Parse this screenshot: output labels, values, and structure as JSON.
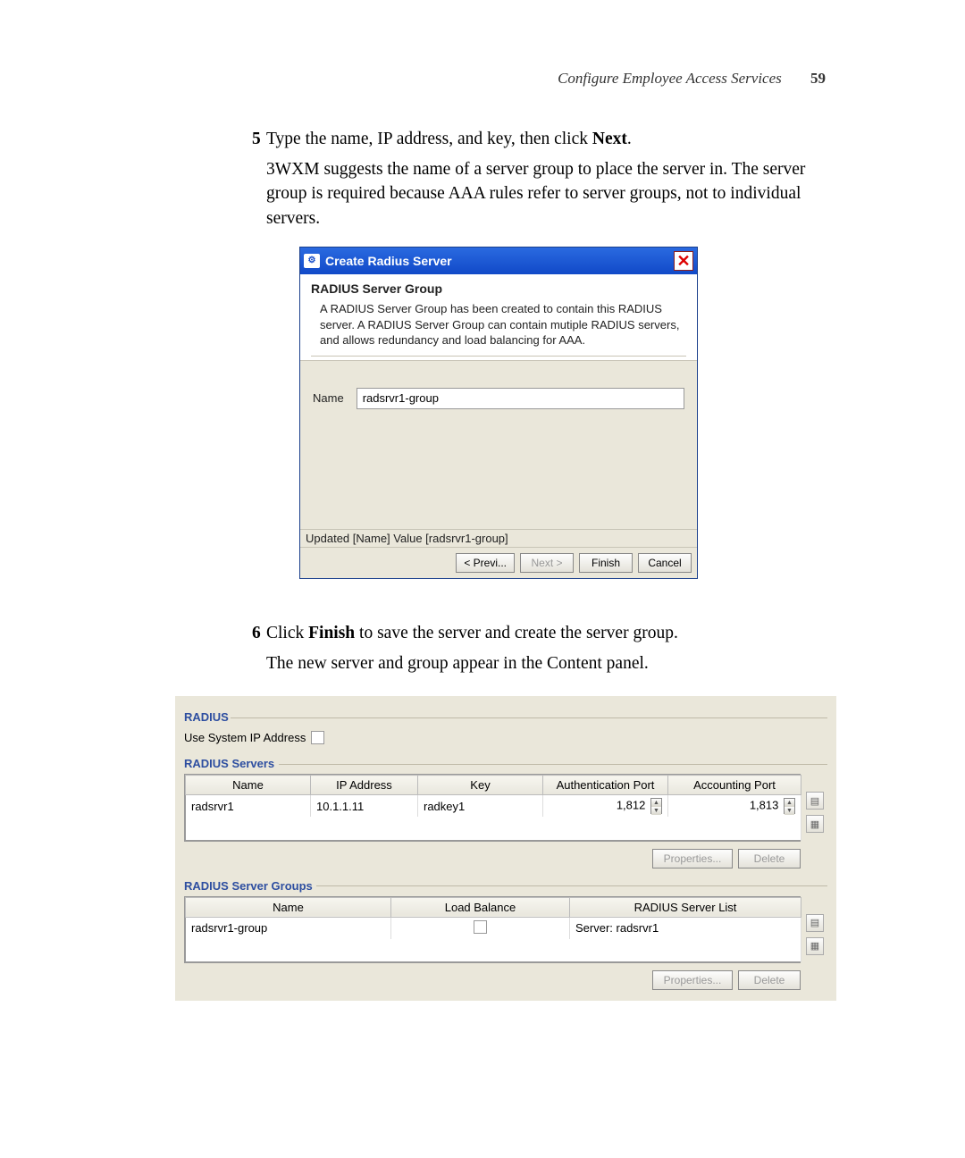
{
  "header": {
    "section_title": "Configure Employee Access Services",
    "page_number": "59"
  },
  "step5": {
    "number": "5",
    "intro_before": "Type the name, IP address, and key, then click ",
    "intro_bold": "Next",
    "intro_after": ".",
    "para": "3WXM suggests the name of a server group to place the server in. The server group is required because AAA rules refer to server groups, not to individual servers."
  },
  "dialog": {
    "title": "Create Radius Server",
    "heading": "RADIUS Server Group",
    "description": "A RADIUS Server Group has been created to contain this RADIUS server. A RADIUS Server Group can contain mutiple RADIUS servers, and allows redundancy and load balancing for AAA.",
    "name_label": "Name",
    "name_value": "radsrvr1-group",
    "status": "Updated [Name] Value [radsrvr1-group]",
    "buttons": {
      "prev": "< Previ...",
      "next": "Next >",
      "finish": "Finish",
      "cancel": "Cancel"
    }
  },
  "step6": {
    "number": "6",
    "intro_before": "Click ",
    "intro_bold": "Finish",
    "intro_after": " to save the server and create the server group.",
    "para": "The new server and group appear in the Content panel."
  },
  "panel": {
    "radius_label": "RADIUS",
    "use_sys_ip": "Use System IP Address",
    "servers_label": "RADIUS Servers",
    "servers_table": {
      "headers": [
        "Name",
        "IP Address",
        "Key",
        "Authentication Port",
        "Accounting Port"
      ],
      "rows": [
        {
          "name": "radsrvr1",
          "ip": "10.1.1.11",
          "key": "radkey1",
          "auth_port": "1,812",
          "acct_port": "1,813"
        }
      ]
    },
    "groups_label": "RADIUS Server Groups",
    "groups_table": {
      "headers": [
        "Name",
        "Load Balance",
        "RADIUS Server List"
      ],
      "rows": [
        {
          "name": "radsrvr1-group",
          "load_balance_checked": false,
          "server_list": "Server: radsrvr1"
        }
      ]
    },
    "properties_btn": "Properties...",
    "delete_btn": "Delete"
  }
}
